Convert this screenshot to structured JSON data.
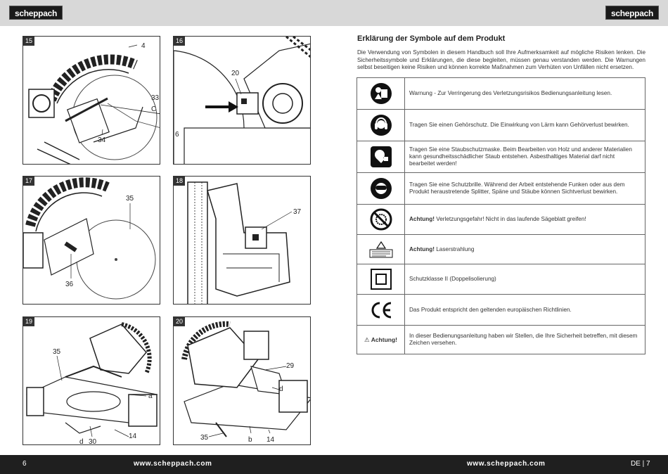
{
  "header": {
    "brand_left": "scheppach",
    "brand_right": "scheppach"
  },
  "footer": {
    "page_left": "6",
    "url_left": "www.scheppach.com",
    "url_right": "www.scheppach.com",
    "page_right": "DE | 7"
  },
  "figures": [
    {
      "number": "15",
      "labels": [
        "4",
        "33",
        "C",
        "34"
      ]
    },
    {
      "number": "16",
      "labels": [
        "20",
        "6"
      ]
    },
    {
      "number": "17",
      "labels": [
        "35",
        "36"
      ]
    },
    {
      "number": "18",
      "labels": [
        "37"
      ]
    },
    {
      "number": "19",
      "labels": [
        "35",
        "a",
        "d",
        "30",
        "14"
      ]
    },
    {
      "number": "20",
      "labels": [
        "29",
        "d",
        "35",
        "b",
        "14"
      ]
    }
  ],
  "symbols_section": {
    "title": "Erklärung der Symbole auf dem Produkt",
    "intro": "Die Verwendung von Symbolen in diesem Handbuch soll Ihre Aufmerksamkeit auf mögliche Risiken lenken. Die Sicherheitssymbole und Erklärungen, die diese begleiten, müssen genau verstanden werden. Die Warnungen selbst beseitigen keine Risiken und können korrekte Maßnahmen zum Verhüten von Unfällen nicht ersetzen.",
    "rows": [
      {
        "icon": "read-manual-icon",
        "bold": "",
        "text": "Warnung - Zur Verringerung des Verletzungsrisikos Bedienungsanleitung lesen."
      },
      {
        "icon": "ear-protection-icon",
        "bold": "",
        "text": "Tragen Sie einen Gehörschutz. Die Einwirkung von Lärm kann Gehörverlust bewirken."
      },
      {
        "icon": "dust-mask-icon",
        "bold": "",
        "text": "Tragen Sie eine Staubschutzmaske. Beim Bearbeiten von Holz und anderer Materialien kann gesundheitsschädlicher Staub entstehen. Asbesthaltiges Material darf nicht bearbeitet werden!"
      },
      {
        "icon": "safety-goggles-icon",
        "bold": "",
        "text": "Tragen Sie eine Schutzbrille. Während der Arbeit entstehende Funken oder aus dem Produkt heraustretende Splitter, Späne und Stäube können Sichtverlust bewirken."
      },
      {
        "icon": "no-hands-blade-icon",
        "bold": "Achtung!",
        "text": " Verletzungsgefahr! Nicht in das laufende Sägeblatt greifen!"
      },
      {
        "icon": "laser-label-icon",
        "bold": "Achtung!",
        "text": " Laserstrahlung"
      },
      {
        "icon": "protection-class-2-icon",
        "bold": "",
        "text": "Schutzklasse II (Doppelisolierung)"
      },
      {
        "icon": "ce-mark-icon",
        "bold": "",
        "text": "Das Produkt entspricht den geltenden europäischen Richtlinien."
      },
      {
        "icon": "warning-triangle-icon",
        "icon_text": "Achtung!",
        "bold": "",
        "text": "In dieser Bedienungsanleitung haben wir Stellen, die Ihre Sicherheit betreffen, mit diesem Zeichen versehen."
      }
    ]
  }
}
